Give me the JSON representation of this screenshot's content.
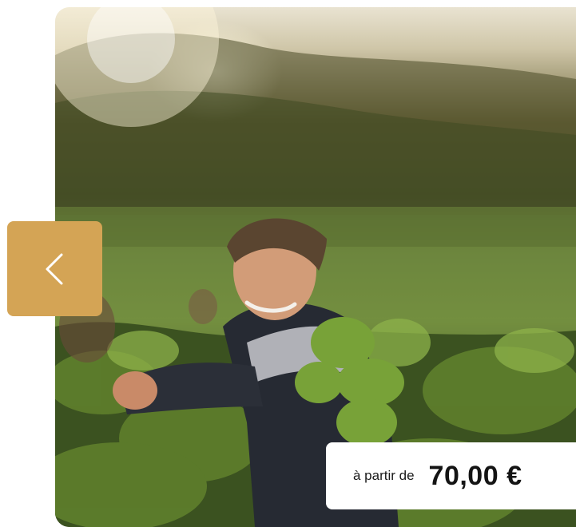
{
  "carousel": {
    "image_alt": "Vendangeur souriant dans les vignes au soleil",
    "prev_icon": "chevron-left-icon",
    "accent_color": "#d4a455"
  },
  "price": {
    "prefix": "à partir de",
    "value": "70,00 €"
  }
}
